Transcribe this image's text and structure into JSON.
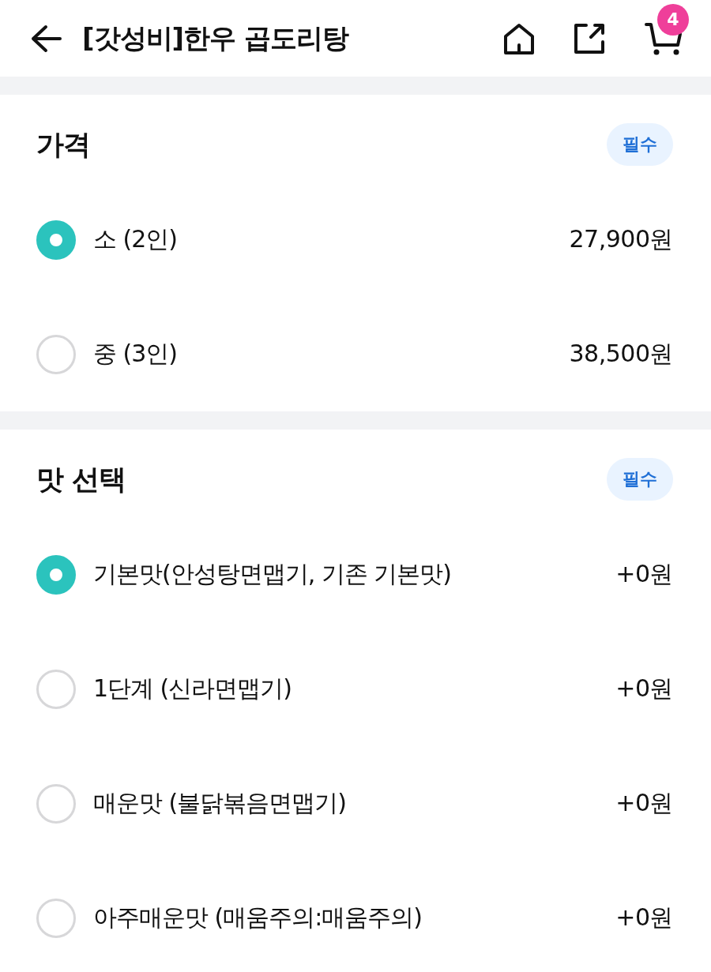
{
  "header": {
    "title": "[갓성비]한우 곱도리탕",
    "cart_count": "4"
  },
  "sections": [
    {
      "title": "가격",
      "badge": "필수",
      "options": [
        {
          "label": "소 (2인)",
          "price": "27,900원",
          "selected": true
        },
        {
          "label": "중 (3인)",
          "price": "38,500원",
          "selected": false
        }
      ]
    },
    {
      "title": "맛 선택",
      "badge": "필수",
      "options": [
        {
          "label": "기본맛(안성탕면맵기, 기존 기본맛)",
          "price": "+0원",
          "selected": true
        },
        {
          "label": "1단계 (신라면맵기)",
          "price": "+0원",
          "selected": false
        },
        {
          "label": "매운맛 (불닭볶음면맵기)",
          "price": "+0원",
          "selected": false
        },
        {
          "label": "아주매운맛 (매움주의:매움주의)",
          "price": "+0원",
          "selected": false
        }
      ]
    }
  ]
}
